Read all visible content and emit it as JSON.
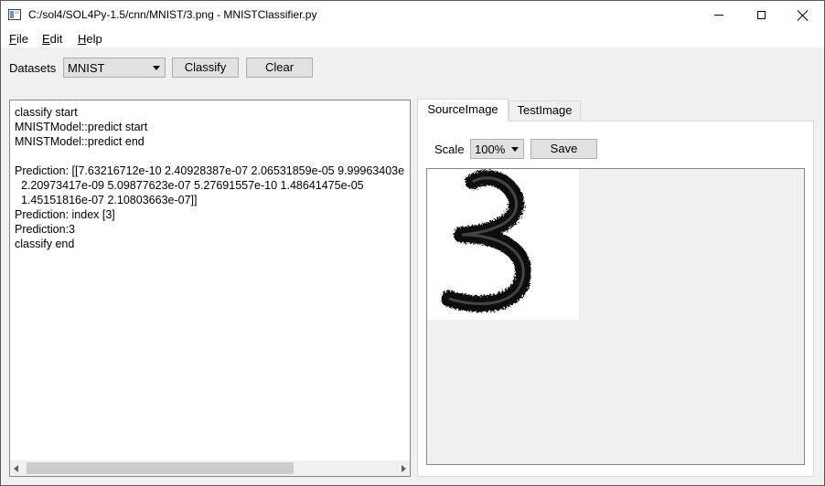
{
  "window": {
    "title": "C:/sol4/SOL4Py-1.5/cnn/MNIST/3.png - MNISTClassifier.py"
  },
  "menu": {
    "file": {
      "accel": "F",
      "rest": "ile"
    },
    "edit": {
      "accel": "E",
      "rest": "dit"
    },
    "help": {
      "accel": "H",
      "rest": "elp"
    }
  },
  "toolbar": {
    "datasets_label": "Datasets",
    "datasets_value": "MNIST",
    "classify_label": "Classify",
    "clear_label": "Clear"
  },
  "log": {
    "text": "classify start\nMNISTModel::predict start\nMNISTModel::predict end\n\nPrediction: [[7.63216712e-10 2.40928387e-07 2.06531859e-05 9.99963403e\n  2.20973417e-09 5.09877623e-07 5.27691557e-10 1.48641475e-05\n  1.45151816e-07 2.10803663e-07]]\nPrediction: index [3]\nPrediction:3\nclassify end"
  },
  "tabs": [
    {
      "label": "SourceImage",
      "active": true
    },
    {
      "label": "TestImage",
      "active": false
    }
  ],
  "image_panel": {
    "scale_label": "Scale",
    "scale_value": "100%",
    "save_label": "Save",
    "digit_image": "handwritten digit 3 (MNIST sample)"
  }
}
